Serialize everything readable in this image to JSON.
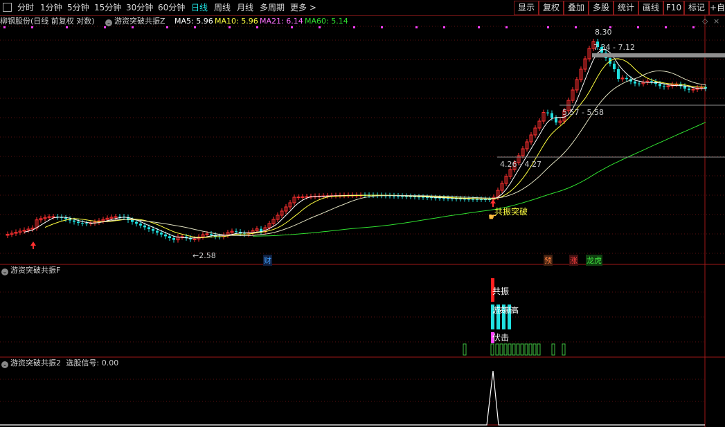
{
  "toolbar": {
    "periods": [
      "分时",
      "1分钟",
      "5分钟",
      "15分钟",
      "30分钟",
      "60分钟",
      "日线",
      "周线",
      "月线",
      "多周期",
      "更多 >"
    ],
    "active_period": "日线",
    "right_buttons": [
      "显示",
      "复权",
      "叠加",
      "多股",
      "统计",
      "画线",
      "F10",
      "标记",
      "+自选"
    ]
  },
  "main_panel": {
    "stock_title": "柳钢股份(日线 前复权 对数)",
    "indicator_name": "游资突破共振Z",
    "ma5": "MA5: 5.96",
    "ma10": "MA10: 5.96",
    "ma21": "MA21: 6.14",
    "ma60": "MA60: 5.14",
    "price_high": "8.30",
    "price_low": "2.58",
    "level_1": "7.34 - 7.12",
    "level_2": "5.57 - 5.58",
    "level_3": "4.26 - 4.27",
    "signal_label": "共振突破",
    "badge_cai": "财",
    "badge_yu": "预",
    "badge_zhang": "涨",
    "badge_longhu": "龙虎"
  },
  "panel_f": {
    "title": "游资突破共振F",
    "label_gongzhen": "共振",
    "label_high": "游资新高",
    "label_fuji": "伏击"
  },
  "panel_2": {
    "title": "游资突破共振2",
    "signal_text": "选股信号: 0.00"
  },
  "colors": {
    "up": "#ff3030",
    "down": "#20e0e0",
    "ma5": "#ffffff",
    "ma10": "#ffff40",
    "ma21": "#ff40ff",
    "ma60": "#30e030",
    "grid": "#5a1010"
  }
}
